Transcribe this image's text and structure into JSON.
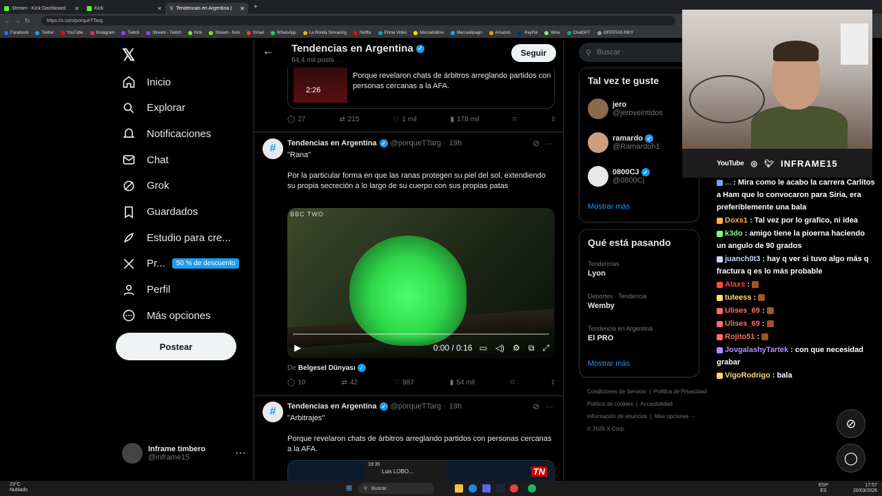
{
  "browser": {
    "tabs": [
      {
        "title": "Stream - Kick Dashboard"
      },
      {
        "title": "Kick"
      },
      {
        "title": "Tendencias en Argentina (@po"
      }
    ],
    "url": "https://x.com/porqueTTarg",
    "bookmarks": [
      "Facebook",
      "Twitter",
      "YouTube",
      "Instagram",
      "Twitch",
      "Stream - Twitch",
      "Kick",
      "Stream - Kick",
      "Gmail",
      "WhatsApp",
      "La Ronda Simracing",
      "Netflix",
      "Prime Video",
      "Mercadolibre",
      "Mercadopago",
      "Amazon.",
      "PayPal",
      "Wise",
      "ChatGPT",
      "OFERTAS RIKY"
    ]
  },
  "nav": {
    "items": [
      {
        "label": "Inicio",
        "icon": "home-icon"
      },
      {
        "label": "Explorar",
        "icon": "search-icon"
      },
      {
        "label": "Notificaciones",
        "icon": "bell-icon"
      },
      {
        "label": "Chat",
        "icon": "mail-icon"
      },
      {
        "label": "Grok",
        "icon": "grok-icon"
      },
      {
        "label": "Guardados",
        "icon": "bookmark-icon"
      },
      {
        "label": "Estudio para cre...",
        "icon": "rocket-icon"
      },
      {
        "label": "Pr...",
        "icon": "x-icon"
      },
      {
        "label": "Perfil",
        "icon": "person-icon"
      },
      {
        "label": "Más opciones",
        "icon": "more-circle-icon"
      }
    ],
    "promo_badge": "50 % de descuento",
    "post_button": "Postear",
    "user": {
      "name": "Inframe timbero",
      "handle": "@inframe15"
    }
  },
  "header": {
    "title": "Tendencias en Argentina",
    "subtitle": "64,4 mil posts",
    "follow": "Seguir"
  },
  "tweet0": {
    "card_text": "Porque revelaron chats de árbitros arreglando partidos con personas cercanas a la AFA.",
    "card_thumb_time": "2:26",
    "replies": "27",
    "reposts": "215",
    "likes": "1 mil",
    "views": "178 mil"
  },
  "tweet1": {
    "name": "Tendencias en Argentina",
    "handle": "@porqueTTarg",
    "time": "19h",
    "title": "\"Rana\"",
    "body": "Por la particular forma en que las ranas protegen su piel del sol, extendiendo su propia secreción a lo largo de su cuerpo con sus propias patas",
    "video_watermark": "BBC TWO",
    "video_time": "0:00 / 0:16",
    "video_progress": 0,
    "from_prefix": "De",
    "from_account": "Belgesel Dünyası",
    "replies": "10",
    "reposts": "42",
    "likes": "987",
    "views": "54 mil"
  },
  "tweet2": {
    "name": "Tendencias en Argentina",
    "handle": "@porqueTTarg",
    "time": "19h",
    "title": "\"Arbitrajes\"",
    "body": "Porque revelaron chats de árbitros arreglando partidos con personas cercanas a la AFA.",
    "thumb_time": "19:35",
    "thumb_label": "Luis LOBO...",
    "thumb_logo": "TN"
  },
  "right": {
    "search_placeholder": "Buscar",
    "suggest_title": "Tal vez te guste",
    "suggestions": [
      {
        "name": "jero",
        "handle": "@jeroveintidos",
        "verified": false
      },
      {
        "name": "ramardo",
        "handle": "@Ramardoh1",
        "verified": true
      },
      {
        "name": "0800CJ",
        "handle": "@0800Cj",
        "verified": true
      }
    ],
    "show_more": "Mostrar más",
    "trending_title": "Qué está pasando",
    "trends": [
      {
        "category": "Tendencias",
        "value": "Lyon"
      },
      {
        "category": "Deportes · Tendencia",
        "value": "Wemby"
      },
      {
        "category": "Tendencia en Argentina",
        "value": "El PRO"
      }
    ],
    "show_more2": "Mostrar más",
    "footer": [
      "Condiciones de Servicio",
      "Política de Privacidad",
      "Política de cookies",
      "Accesibilidad",
      "Información de anuncios",
      "Más opciones ···",
      "© 2026 X Corp."
    ]
  },
  "stream": {
    "youtube": "YouTube",
    "brand": "INFRAME15",
    "chat": [
      {
        "user": "...",
        "text": "Mira como le acabo la carrera Carlitos a Ham que lo convocaron para Siria, era preferiblemente una bala",
        "color": "#5fa8ff"
      },
      {
        "user": "Doxs1",
        "text": "Tal vez por lo grafico, ni idea",
        "color": "#ffb347"
      },
      {
        "user": "k3do",
        "text": "amigo tiene la pioerna haciendo un angulo de 90 grados",
        "color": "#7dff7d"
      },
      {
        "user": "juanch0t3",
        "text": "hay q ver si tuvo algo más q fractura q es lo más probable",
        "color": "#c9d4ff"
      },
      {
        "user": "Alaxs",
        "text": "",
        "color": "#ff4a4a"
      },
      {
        "user": "tuteess",
        "text": "",
        "color": "#ffe066"
      },
      {
        "user": "Ulises_69",
        "text": "",
        "color": "#ff6b6b"
      },
      {
        "user": "Ulises_69",
        "text": "",
        "color": "#ff6b6b"
      },
      {
        "user": "Rojito51",
        "text": "",
        "color": "#ff6b6b"
      },
      {
        "user": "JovgalashyTartek",
        "text": "con que necesidad grabar",
        "color": "#b48cff"
      },
      {
        "user": "VigoRodrigo",
        "text": "bala",
        "color": "#ffd27f"
      }
    ]
  },
  "taskbar": {
    "weather_temp": "23°C",
    "weather_desc": "Nublado",
    "search": "Buscar",
    "lang": "ESP",
    "lang2": "ES",
    "time": "17:57",
    "date": "20/03/2026"
  }
}
